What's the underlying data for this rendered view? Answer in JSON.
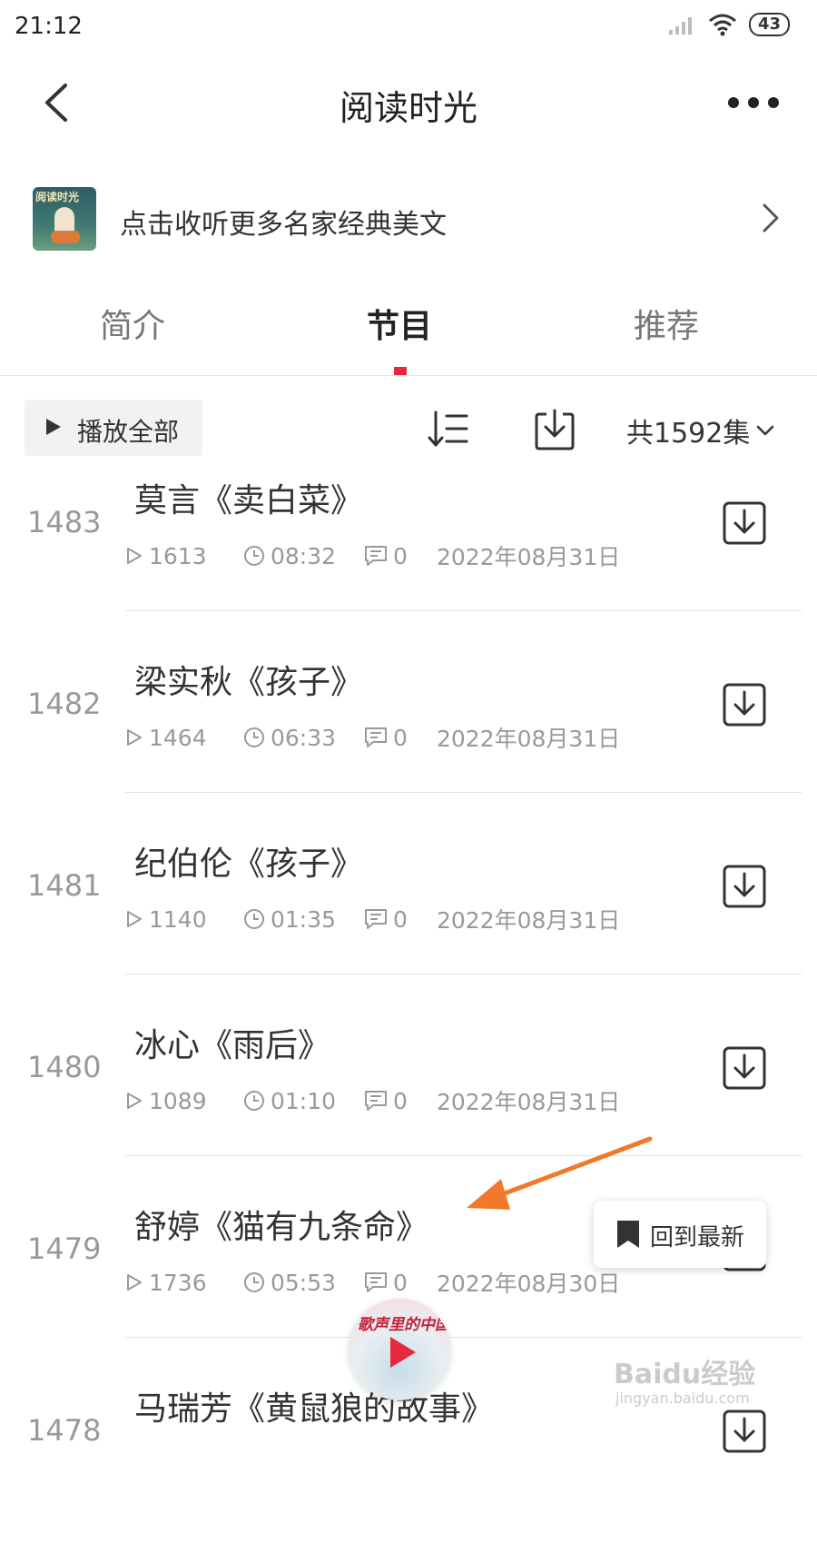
{
  "status_bar": {
    "time": "21:12",
    "battery": "43"
  },
  "header": {
    "title": "阅读时光"
  },
  "promo": {
    "thumb_text": "阅读时光",
    "text": "点击收听更多名家经典美文"
  },
  "tabs": [
    {
      "label": "简介"
    },
    {
      "label": "节目"
    },
    {
      "label": "推荐"
    }
  ],
  "toolbar": {
    "play_all": "播放全部",
    "episode_count": "共1592集"
  },
  "episodes": [
    {
      "index": "1483",
      "title": "莫言《卖白菜》",
      "plays": "1613",
      "duration": "08:32",
      "comments": "0",
      "date": "2022年08月31日"
    },
    {
      "index": "1482",
      "title": "梁实秋《孩子》",
      "plays": "1464",
      "duration": "06:33",
      "comments": "0",
      "date": "2022年08月31日"
    },
    {
      "index": "1481",
      "title": "纪伯伦《孩子》",
      "plays": "1140",
      "duration": "01:35",
      "comments": "0",
      "date": "2022年08月31日"
    },
    {
      "index": "1480",
      "title": "冰心《雨后》",
      "plays": "1089",
      "duration": "01:10",
      "comments": "0",
      "date": "2022年08月31日"
    },
    {
      "index": "1479",
      "title": "舒婷《猫有九条命》",
      "plays": "1736",
      "duration": "05:53",
      "comments": "0",
      "date": "2022年08月30日"
    },
    {
      "index": "1478",
      "title": "马瑞芳《黄鼠狼的故事》"
    }
  ],
  "back_to_latest": {
    "label": "回到最新"
  },
  "mini_player": {
    "caption": "歌声里的中国"
  },
  "watermark": {
    "text": "Baidu经验",
    "sub": "jingyan.baidu.com"
  },
  "colors": {
    "accent": "#e8283c",
    "annotation": "#f07a2a"
  }
}
